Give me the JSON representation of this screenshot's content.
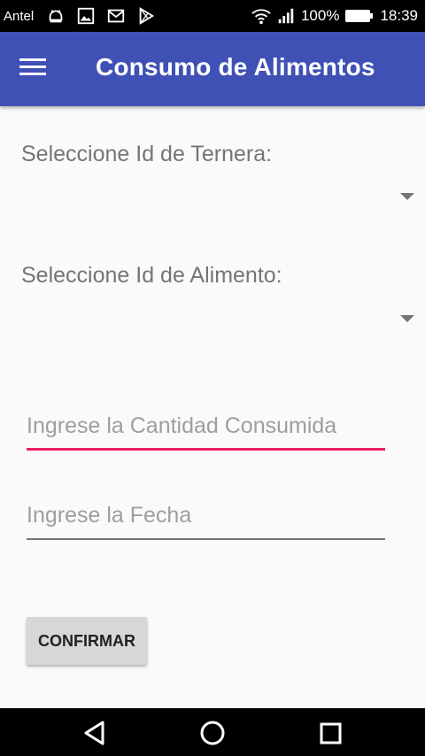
{
  "status_bar": {
    "carrier": "Antel",
    "notification_icons": [
      "android-icon",
      "image-icon",
      "mail-icon",
      "play-store-icon"
    ],
    "battery": "100%",
    "time": "18:39"
  },
  "app_bar": {
    "title": "Consumo de Alimentos"
  },
  "form": {
    "ternera_label": "Seleccione Id de Ternera:",
    "ternera_value": "",
    "alimento_label": "Seleccione Id de Alimento:",
    "alimento_value": "",
    "cantidad_placeholder": "Ingrese la Cantidad Consumida",
    "cantidad_value": "",
    "fecha_placeholder": "Ingrese la Fecha",
    "fecha_value": "",
    "confirm_label": "CONFIRMAR"
  },
  "colors": {
    "primary": "#3f51b5",
    "accent": "#e91e63",
    "background": "#fafafa"
  }
}
